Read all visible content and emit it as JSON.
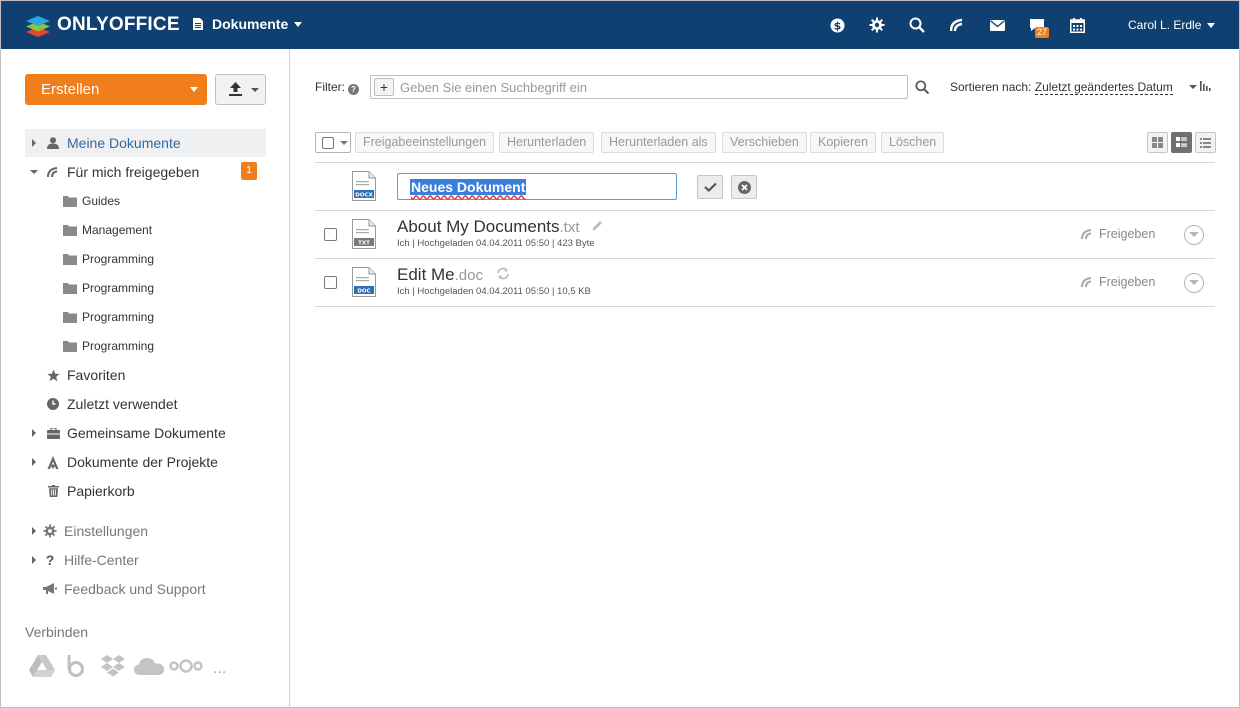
{
  "header": {
    "logo_text": "ONLYOFFICE",
    "module_label": "Dokumente",
    "chat_badge": "27",
    "user_name": "Carol L. Erdle"
  },
  "sidebar": {
    "create_label": "Erstellen",
    "items": [
      {
        "label": "Meine Dokumente"
      },
      {
        "label": "Für mich freigegeben",
        "badge": "1"
      },
      {
        "label": "Favoriten"
      },
      {
        "label": "Zuletzt verwendet"
      },
      {
        "label": "Gemeinsame Dokumente"
      },
      {
        "label": "Dokumente der Projekte"
      },
      {
        "label": "Papierkorb"
      }
    ],
    "shared_folders": [
      "Guides",
      "Management",
      "Programming",
      "Programming",
      "Programming",
      "Programming"
    ],
    "settings": "Einstellungen",
    "help": "Hilfe-Center",
    "feedback": "Feedback und Support",
    "connect_title": "Verbinden",
    "connect_more": "..."
  },
  "filter": {
    "label": "Filter:",
    "placeholder": "Geben Sie einen Suchbegriff ein",
    "sort_label": "Sortieren nach:",
    "sort_value": "Zuletzt geändertes Datum"
  },
  "toolbar": {
    "share": "Freigabeeinstellungen",
    "download": "Herunterladen",
    "download_as": "Herunterladen als",
    "move": "Verschieben",
    "copy": "Kopieren",
    "delete": "Löschen"
  },
  "new_doc": {
    "name": "Neues Dokument",
    "icon_label": "DOCX"
  },
  "files": [
    {
      "name": "About My Documents",
      "ext": ".txt",
      "icon_label": "TXT",
      "meta": "Ich | Hochgeladen 04.04.2011 05:50 | 423 Byte",
      "share_label": "Freigeben"
    },
    {
      "name": "Edit Me",
      "ext": ".doc",
      "icon_label": "DOC",
      "meta": "Ich | Hochgeladen 04.04.2011 05:50 | 10,5 KB",
      "share_label": "Freigeben"
    }
  ],
  "colors": {
    "header_bg": "#0f4071",
    "accent_orange": "#f07e1b",
    "active_link": "#316aa0"
  }
}
